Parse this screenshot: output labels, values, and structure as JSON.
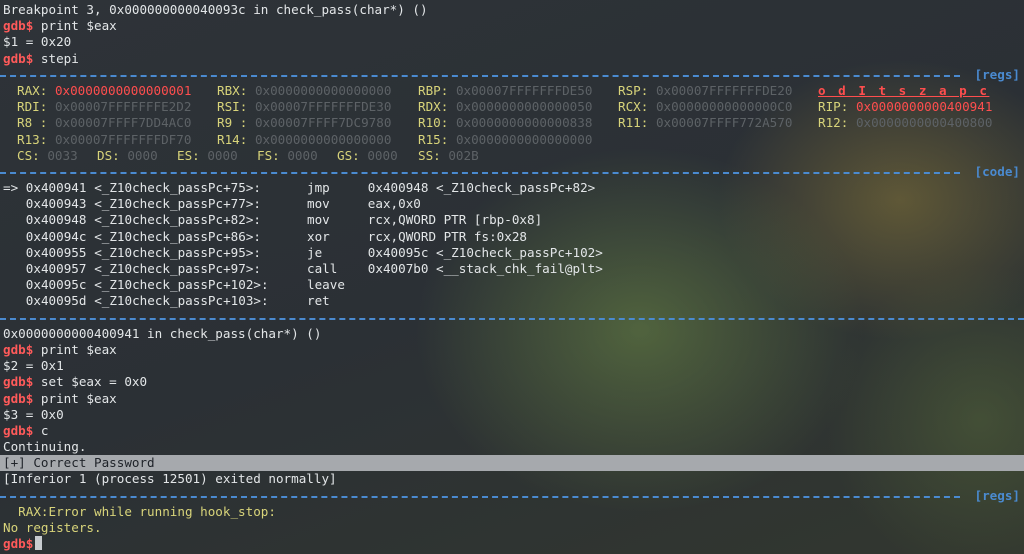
{
  "history": [
    {
      "type": "out",
      "text": "Breakpoint 3, 0x000000000040093c in check_pass(char*) ()"
    },
    {
      "type": "cmd",
      "prompt": "gdb$",
      "text": " print $eax"
    },
    {
      "type": "out",
      "text": "$1 = 0x20"
    },
    {
      "type": "cmd",
      "prompt": "gdb$",
      "text": " stepi"
    }
  ],
  "regs_tag": "[regs]",
  "code_tag": "[code]",
  "registers": {
    "row1": [
      {
        "name": "RAX:",
        "value": "0x0000000000000001",
        "hl": true
      },
      {
        "name": "RBX:",
        "value": "0x0000000000000000",
        "hl": false
      },
      {
        "name": "RBP:",
        "value": "0x00007FFFFFFFDE50",
        "hl": false
      },
      {
        "name": "RSP:",
        "value": "0x00007FFFFFFFDE20",
        "hl": false
      }
    ],
    "flags": "o d I t s z a p c",
    "row2": [
      {
        "name": "RDI:",
        "value": "0x00007FFFFFFFE2D2",
        "hl": false
      },
      {
        "name": "RSI:",
        "value": "0x00007FFFFFFFDE30",
        "hl": false
      },
      {
        "name": "RDX:",
        "value": "0x0000000000000050",
        "hl": false
      },
      {
        "name": "RCX:",
        "value": "0x00000000000000C0",
        "hl": false
      },
      {
        "name": "RIP:",
        "value": "0x0000000000400941",
        "hl": true
      }
    ],
    "row3": [
      {
        "name": "R8 :",
        "value": "0x00007FFFF7DD4AC0",
        "hl": false
      },
      {
        "name": "R9 :",
        "value": "0x00007FFFF7DC9780",
        "hl": false
      },
      {
        "name": "R10:",
        "value": "0x0000000000000838",
        "hl": false
      },
      {
        "name": "R11:",
        "value": "0x00007FFFF772A570",
        "hl": false
      },
      {
        "name": "R12:",
        "value": "0x0000000000400800",
        "hl": false
      }
    ],
    "row4": [
      {
        "name": "R13:",
        "value": "0x00007FFFFFFFDF70",
        "hl": false
      },
      {
        "name": "R14:",
        "value": "0x0000000000000000",
        "hl": false
      },
      {
        "name": "R15:",
        "value": "0x0000000000000000",
        "hl": false
      }
    ],
    "segments": [
      {
        "name": "CS:",
        "value": "0033"
      },
      {
        "name": "DS:",
        "value": "0000"
      },
      {
        "name": "ES:",
        "value": "0000"
      },
      {
        "name": "FS:",
        "value": "0000"
      },
      {
        "name": "GS:",
        "value": "0000"
      },
      {
        "name": "SS:",
        "value": "002B"
      }
    ]
  },
  "code": [
    {
      "marker": "=>",
      "addr": "0x400941",
      "sym": "<_Z10check_passPc+75>:",
      "mnem": "jmp",
      "ops": "0x400948 <_Z10check_passPc+82>"
    },
    {
      "marker": "",
      "addr": "0x400943",
      "sym": "<_Z10check_passPc+77>:",
      "mnem": "mov",
      "ops": "eax,0x0"
    },
    {
      "marker": "",
      "addr": "0x400948",
      "sym": "<_Z10check_passPc+82>:",
      "mnem": "mov",
      "ops": "rcx,QWORD PTR [rbp-0x8]"
    },
    {
      "marker": "",
      "addr": "0x40094c",
      "sym": "<_Z10check_passPc+86>:",
      "mnem": "xor",
      "ops": "rcx,QWORD PTR fs:0x28"
    },
    {
      "marker": "",
      "addr": "0x400955",
      "sym": "<_Z10check_passPc+95>:",
      "mnem": "je",
      "ops": "0x40095c <_Z10check_passPc+102>"
    },
    {
      "marker": "",
      "addr": "0x400957",
      "sym": "<_Z10check_passPc+97>:",
      "mnem": "call",
      "ops": "0x4007b0 <__stack_chk_fail@plt>"
    },
    {
      "marker": "",
      "addr": "0x40095c",
      "sym": "<_Z10check_passPc+102>:",
      "mnem": "leave",
      "ops": ""
    },
    {
      "marker": "",
      "addr": "0x40095d",
      "sym": "<_Z10check_passPc+103>:",
      "mnem": "ret",
      "ops": ""
    }
  ],
  "after": [
    {
      "type": "out",
      "text": "0x0000000000400941 in check_pass(char*) ()"
    },
    {
      "type": "cmd",
      "prompt": "gdb$",
      "text": " print $eax"
    },
    {
      "type": "out",
      "text": "$2 = 0x1"
    },
    {
      "type": "cmd",
      "prompt": "gdb$",
      "text": " set $eax = 0x0"
    },
    {
      "type": "cmd",
      "prompt": "gdb$",
      "text": " print $eax"
    },
    {
      "type": "out",
      "text": "$3 = 0x0"
    },
    {
      "type": "cmd",
      "prompt": "gdb$",
      "text": " c"
    },
    {
      "type": "out",
      "text": "Continuing."
    }
  ],
  "success_line": "[+] Correct Password",
  "exit_line": "[Inferior 1 (process 12501) exited normally]",
  "error_line": "  RAX:Error while running hook_stop:",
  "noregs_line": "No registers.",
  "final_prompt": "gdb$"
}
